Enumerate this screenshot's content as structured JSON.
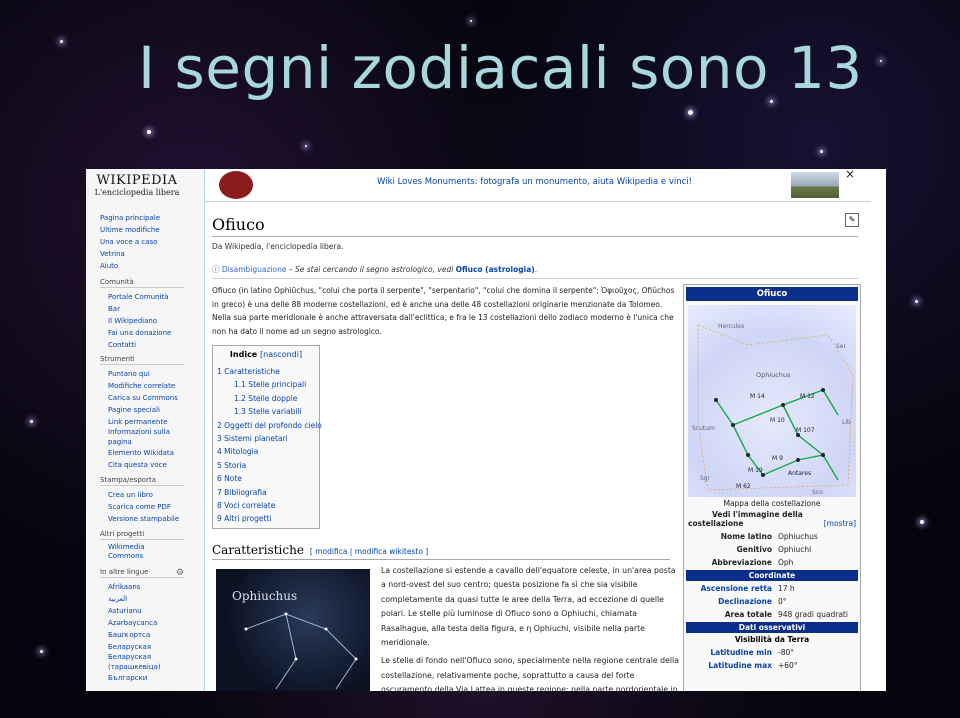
{
  "slide": {
    "title": "I segni zodiacali sono 13"
  },
  "wiki": {
    "logo_title": "WIKIPEDIA",
    "logo_sub": "L'enciclopedia libera",
    "banner_text": "Wiki Loves Monuments: fotografa un monumento, aiuta Wikipedia e vinci!",
    "close_icon": "×",
    "nav_main": [
      "Pagina principale",
      "Ultime modifiche",
      "Una voce a caso",
      "Vetrina",
      "Aiuto"
    ],
    "comunita_head": "Comunità",
    "comunita": [
      "Portale Comunità",
      "Bar",
      "Il Wikipediano",
      "Fai una donazione",
      "Contatti"
    ],
    "strumenti_head": "Strumenti",
    "strumenti": [
      "Puntano qui",
      "Modifiche correlate",
      "Carica su Commons",
      "Pagine speciali",
      "Link permanente",
      "Informazioni sulla",
      "pagina",
      "Elemento Wikidata",
      "Cita questa voce"
    ],
    "stampa_head": "Stampa/esporta",
    "stampa": [
      "Crea un libro",
      "Scarica come PDF",
      "Versione stampabile"
    ],
    "altri_head": "Altri progetti",
    "altri": [
      "Wikimedia",
      "Commons"
    ],
    "lingue_head": "In altre lingue",
    "lingue": [
      "Afrikaans",
      "العربية",
      "Asturianu",
      "Azərbaycanca",
      "Башҡортса",
      "Беларуская",
      "Беларуская",
      "(тарашкевіца)",
      "Български"
    ],
    "page_title": "Ofiuco",
    "from_line": "Da Wikipedia, l'enciclopedia libera.",
    "disamb": {
      "label": "Disambiguazione",
      "text": " – Se stai cercando il segno astrologico, vedi ",
      "link": "Ofiuco (astrologia)",
      "end": "."
    },
    "intro": "Ofiuco (in latino Ophiūchus, \"colui che porta il serpente\", \"serpentario\", \"colui che domina il serpente\"; Ὀφιοῦχος, Ofiûchos in greco) è una delle 88 moderne costellazioni, ed è anche una delle 48 costellazioni originarie menzionate da Tolomeo. Nella sua parte meridionale è anche attraversata dall'eclittica, e fra le 13 costellazioni dello zodiaco moderno è l'unica che non ha dato il nome ad un segno astrologico.",
    "toc": {
      "title": "Indice",
      "toggle": "[nascondi]",
      "items": [
        "1 Caratteristiche",
        "1.1 Stelle principali",
        "1.2 Stelle doppie",
        "1.3 Stelle variabili",
        "2 Oggetti del profondo cielo",
        "3 Sistemi planetari",
        "4 Mitologia",
        "5 Storia",
        "6 Note",
        "7 Bibliografia",
        "8 Voci correlate",
        "9 Altri progetti"
      ]
    },
    "section_title": "Caratteristiche",
    "section_edit": "[ modifica | modifica wikitesto ]",
    "section_image_label": "Ophiuchus",
    "section_text": "La costellazione si estende a cavallo dell'equatore celeste, in un'area posta a nord-ovest del suo centro; questa posizione fa sì che sia visibile completamente da quasi tutte le aree della Terra, ad eccezione di quelle polari. Le stelle più luminose di Ofiuco sono α Ophiuchi, chiamata Rasalhague, alla testa della figura, e η Ophiuchi, visibile nella parte meridionale.",
    "section_text2": "Le stelle di fondo nell'Ofiuco sono, specialmente nella regione centrale della costellazione, relativamente poche, soprattutto a causa del forte oscuramento della Via Lattea in queste regione: nella parte nordorientale in",
    "infobox": {
      "title": "Ofiuco",
      "map_labels": [
        "Hercules",
        "Ser",
        "Ophiuchus",
        "M 14",
        "M 12",
        "M 10",
        "M 107",
        "M 9",
        "M 19",
        "M 62",
        "Antares",
        "Sco",
        "Lib",
        "Scutum",
        "Sgr"
      ],
      "map_caption": "Mappa della costellazione",
      "show_text": "Vedi l'immagine della costellazione",
      "show_link": "[mostra]",
      "rows1": [
        {
          "k": "Nome latino",
          "v": "Ophiuchus"
        },
        {
          "k": "Genitivo",
          "v": "Ophiuchi"
        },
        {
          "k": "Abbreviazione",
          "v": "Oph"
        }
      ],
      "sec_coord": "Coordinate",
      "rows2": [
        {
          "k": "Ascensione retta",
          "v": "17 h"
        },
        {
          "k": "Declinazione",
          "v": "0°"
        },
        {
          "k": "Area totale",
          "v": "948 gradi quadrati"
        }
      ],
      "sec_oss": "Dati osservativi",
      "vis_head": "Visibilità da Terra",
      "rows3": [
        {
          "k": "Latitudine min",
          "v": "-80°"
        },
        {
          "k": "Latitudine max",
          "v": "+60°"
        }
      ]
    }
  }
}
